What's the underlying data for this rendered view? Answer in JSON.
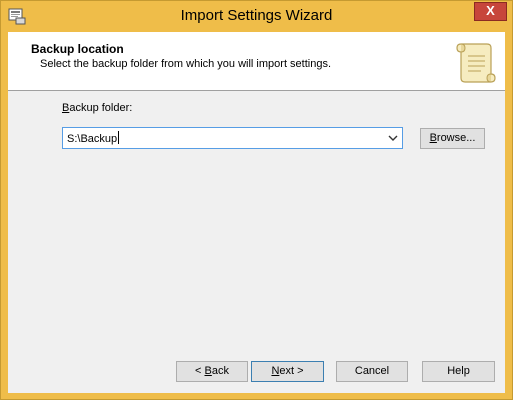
{
  "window": {
    "title": "Import Settings Wizard",
    "close_label": "X"
  },
  "header": {
    "title": "Backup location",
    "subtitle": "Select the backup folder from which you will import settings."
  },
  "form": {
    "backup_folder_label_mnemonic": "B",
    "backup_folder_label_rest": "ackup folder:",
    "backup_folder_value": "S:\\Backup"
  },
  "buttons": {
    "browse_mnemonic": "B",
    "browse_rest": "rowse...",
    "back_prefix": "< ",
    "back_mnemonic": "B",
    "back_rest": "ack",
    "next_mnemonic": "N",
    "next_rest": "ext >",
    "cancel": "Cancel",
    "help": "Help"
  },
  "colors": {
    "title_bar": "#efbd49",
    "close_button": "#c7463b",
    "focus_border": "#569de5"
  }
}
